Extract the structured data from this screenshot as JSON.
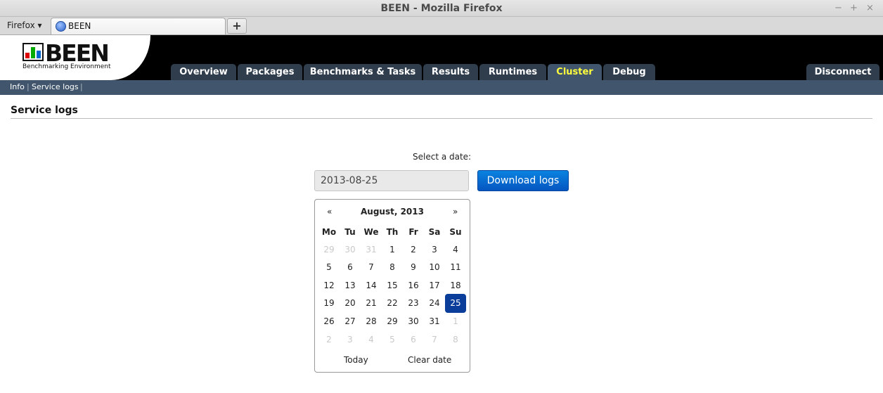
{
  "window": {
    "title": "BEEN - Mozilla Firefox",
    "controls": [
      "−",
      "+",
      "×"
    ]
  },
  "browser": {
    "menu_label": "Firefox ▾",
    "tab_label": "BEEN",
    "newtab_label": "+"
  },
  "app": {
    "logo_text": "BEEN",
    "logo_subtitle": "Benchmarking Environment",
    "nav": [
      {
        "label": "Overview"
      },
      {
        "label": "Packages"
      },
      {
        "label": "Benchmarks & Tasks"
      },
      {
        "label": "Results"
      },
      {
        "label": "Runtimes"
      },
      {
        "label": "Cluster",
        "active": true
      },
      {
        "label": "Debug"
      }
    ],
    "disconnect_label": "Disconnect",
    "subnav": [
      "Info",
      "Service logs"
    ],
    "separator": "|"
  },
  "page": {
    "title": "Service logs",
    "select_label": "Select a date:",
    "date_value": "2013-08-25",
    "download_label": "Download logs"
  },
  "calendar": {
    "prev": "«",
    "next": "»",
    "month_title": "August, 2013",
    "weekdays": [
      "Mo",
      "Tu",
      "We",
      "Th",
      "Fr",
      "Sa",
      "Su"
    ],
    "weeks": [
      [
        "29",
        "30",
        "31",
        "1",
        "2",
        "3",
        "4"
      ],
      [
        "5",
        "6",
        "7",
        "8",
        "9",
        "10",
        "11"
      ],
      [
        "12",
        "13",
        "14",
        "15",
        "16",
        "17",
        "18"
      ],
      [
        "19",
        "20",
        "21",
        "22",
        "23",
        "24",
        "25"
      ],
      [
        "26",
        "27",
        "28",
        "29",
        "30",
        "31",
        "1"
      ],
      [
        "2",
        "3",
        "4",
        "5",
        "6",
        "7",
        "8"
      ]
    ],
    "today_label": "Today",
    "clear_label": "Clear date"
  }
}
